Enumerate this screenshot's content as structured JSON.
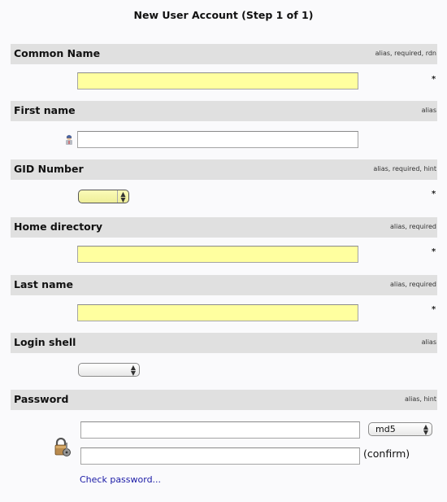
{
  "page_title": "New User Account (Step 1 of 1)",
  "required_marker": "*",
  "fields": [
    {
      "label": "Common Name",
      "flags": "alias, required, rdn",
      "type": "text",
      "required": true,
      "value": ""
    },
    {
      "label": "First name",
      "flags": "alias",
      "type": "text",
      "required": false,
      "value": "",
      "icon": "user-icon"
    },
    {
      "label": "GID Number",
      "flags": "alias, required, hint",
      "type": "select",
      "required": true,
      "value": ""
    },
    {
      "label": "Home directory",
      "flags": "alias, required",
      "type": "text",
      "required": true,
      "value": ""
    },
    {
      "label": "Last name",
      "flags": "alias, required",
      "type": "text",
      "required": true,
      "value": ""
    },
    {
      "label": "Login shell",
      "flags": "alias",
      "type": "select",
      "required": false,
      "value": ""
    },
    {
      "label": "Password",
      "flags": "alias, hint",
      "type": "password",
      "required": false,
      "value": "",
      "confirm_value": "",
      "icon": "lock-key-icon",
      "hash_select": {
        "value": "md5"
      },
      "confirm_label": "(confirm)",
      "check_link": "Check password..."
    }
  ],
  "colors": {
    "header_bg": "#e0e0e0",
    "required_input_bg": "#ffff9f",
    "link": "#1a1aa6",
    "page_bg": "#fafafc"
  }
}
